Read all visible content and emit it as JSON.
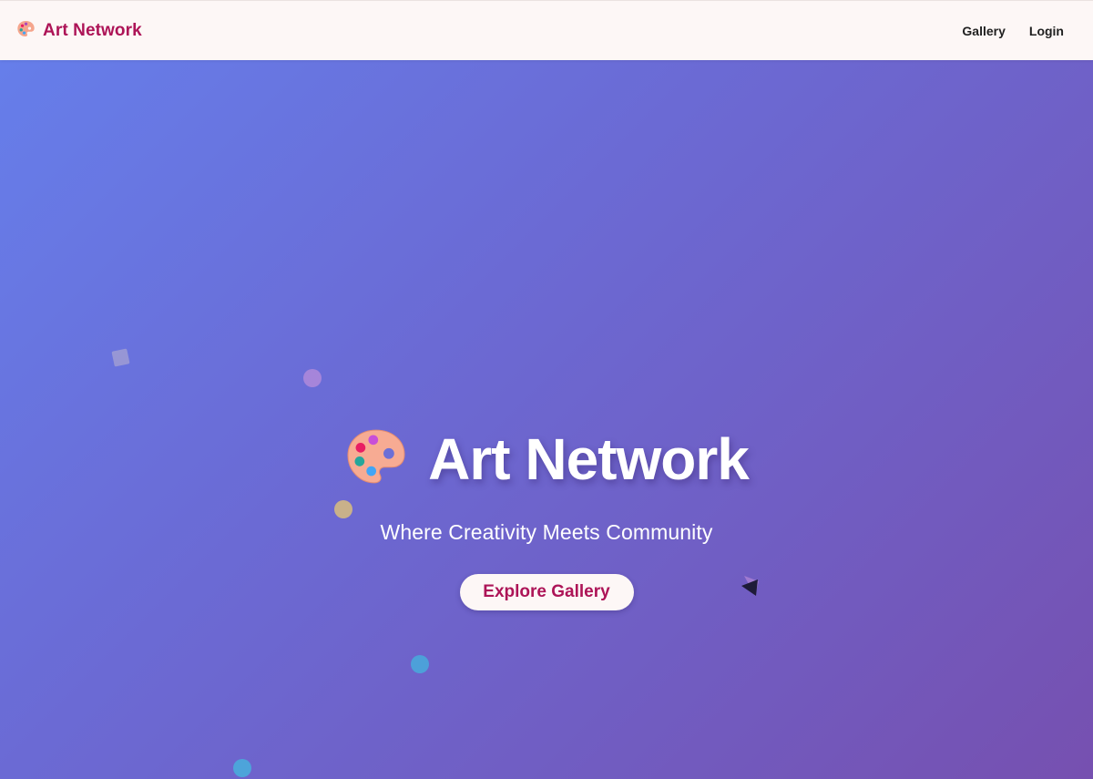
{
  "colors": {
    "brand": "#ad1457",
    "nav_background": "#fdf7f6",
    "hero_gradient_start": "#667eea",
    "hero_gradient_end": "#7650b0",
    "hero_text": "#ffffff"
  },
  "navbar": {
    "brand_icon": "palette-icon",
    "brand_name": "Art Network",
    "links": [
      {
        "label": "Gallery"
      },
      {
        "label": "Login"
      }
    ]
  },
  "hero": {
    "title_icon": "palette-icon",
    "title": "Art Network",
    "subtitle": "Where Creativity Meets Community",
    "cta_label": "Explore Gallery"
  }
}
